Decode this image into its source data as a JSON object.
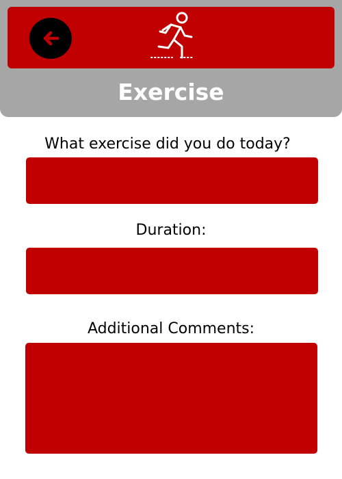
{
  "header": {
    "title": "Exercise",
    "back_icon": "arrow-left-icon",
    "exercise_icon": "running-person-icon"
  },
  "form": {
    "exercise_question": "What exercise did you do today?",
    "exercise_value": "",
    "duration_label": "Duration:",
    "duration_value": "",
    "comments_label": "Additional Comments:",
    "comments_value": ""
  },
  "colors": {
    "accent": "#c00000",
    "header_bg": "#a6a6a6",
    "button_bg": "#000000",
    "title_text": "#ffffff"
  }
}
